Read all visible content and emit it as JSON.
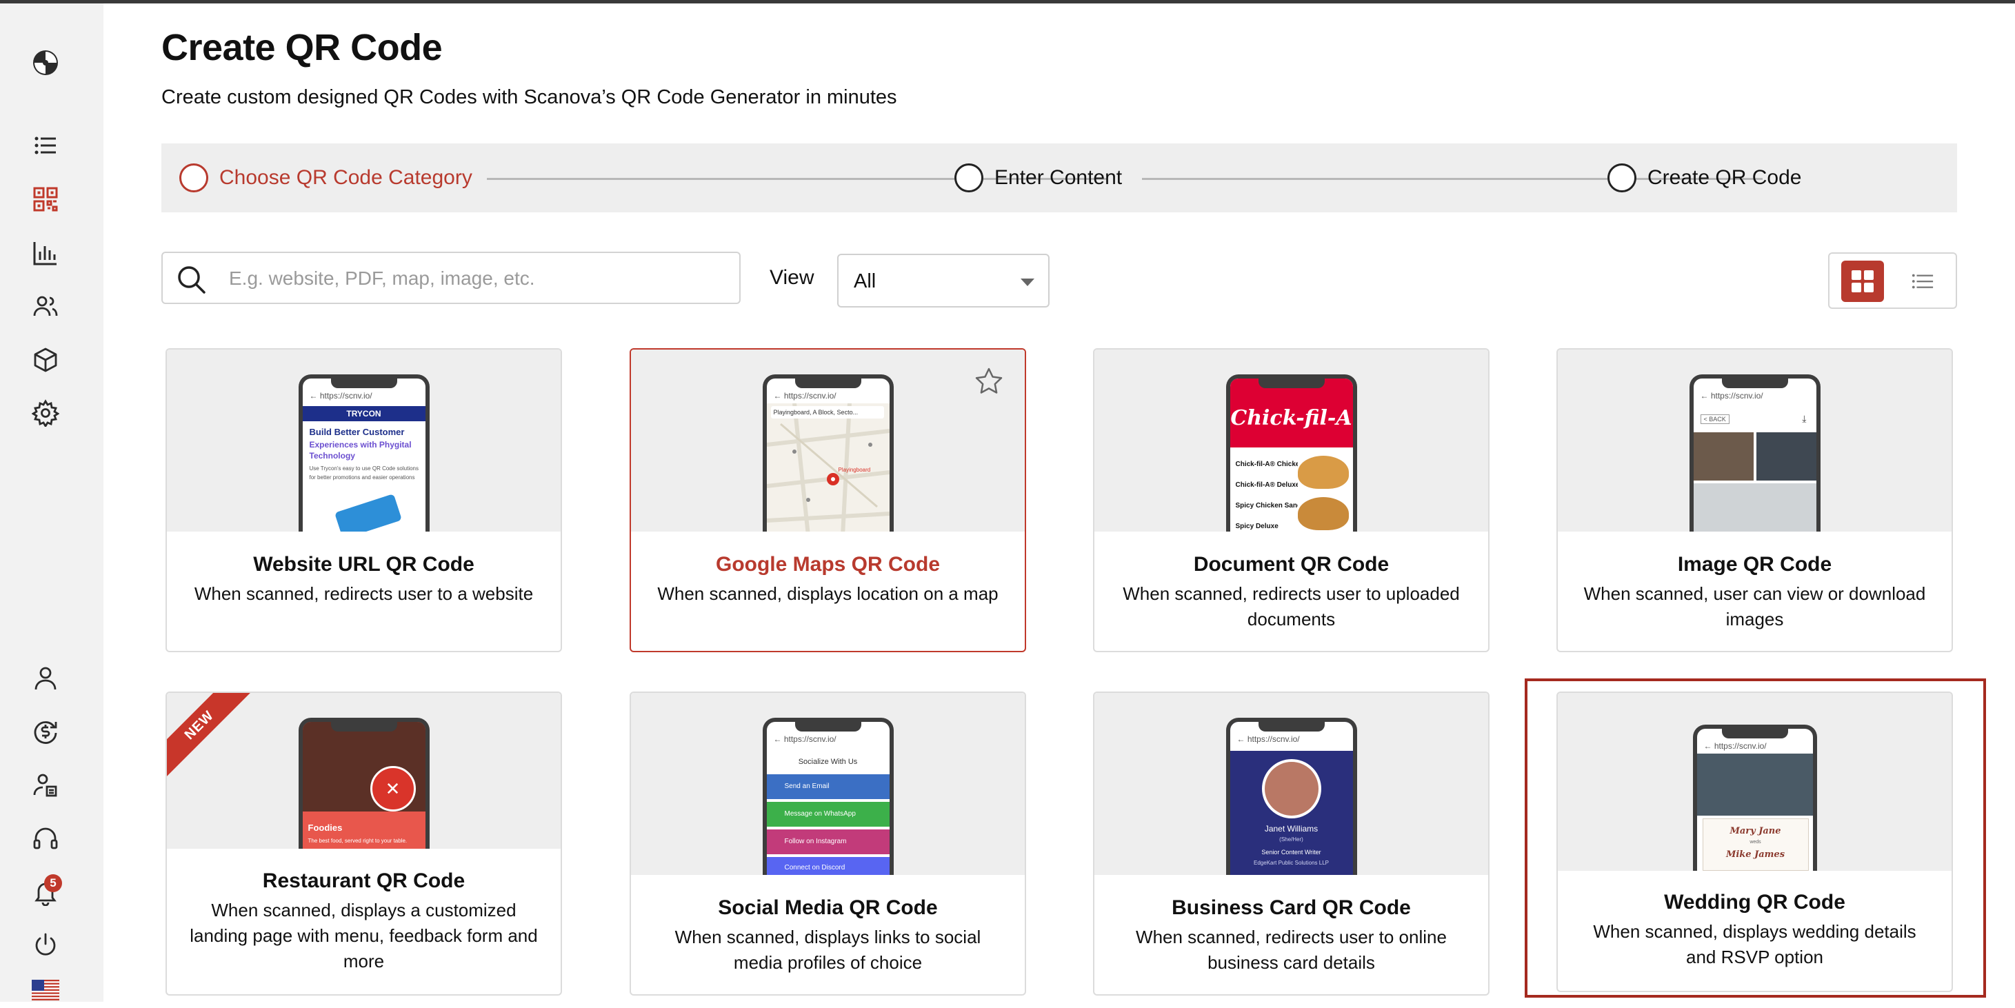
{
  "page": {
    "title": "Create QR Code",
    "subtitle": "Create custom designed QR Codes with Scanova’s QR Code Generator in minutes"
  },
  "sidebar": {
    "icons": [
      "logo-icon",
      "list-icon",
      "qr-icon",
      "chart-icon",
      "users-icon",
      "box-icon",
      "gear-icon",
      "user-icon",
      "billing-icon",
      "admin-user-icon",
      "headset-icon",
      "bell-icon",
      "power-icon",
      "us-flag-icon"
    ],
    "notification_count": "5",
    "accent": "#c0392b"
  },
  "stepper": {
    "steps": [
      {
        "label": "Choose QR Code Category",
        "active": true
      },
      {
        "label": "Enter Content",
        "active": false
      },
      {
        "label": "Create QR Code",
        "active": false
      }
    ]
  },
  "toolbar": {
    "search_placeholder": "E.g. website, PDF, map, image, etc.",
    "view_label": "View",
    "view_value": "All"
  },
  "cards": [
    {
      "title": "Website URL QR Code",
      "desc": "When scanned, redirects user to a website",
      "preview": {
        "url": "← https://scnv.io/",
        "brand": "TRYCON",
        "headline": "Build Better Customer",
        "subline": "Experiences with Phygital Technology",
        "body": "Use Trycon's easy to use QR Code solutions for better promotions and easier operations"
      }
    },
    {
      "title": "Google Maps QR Code",
      "desc": "When scanned, displays location on a map",
      "preview": {
        "url": "← https://scnv.io/",
        "search": "Playingboard, A Block, Secto...",
        "pin": "Playingboard"
      }
    },
    {
      "title": "Document QR Code",
      "desc": "When scanned, redirects user to uploaded documents",
      "preview": {
        "brand": "Chick-fil-A",
        "items": [
          "Chick-fil-A® Chicken",
          "Chick-fil-A® Deluxe",
          "Spicy Chicken Sandwich",
          "Spicy Deluxe"
        ]
      }
    },
    {
      "title": "Image QR Code",
      "desc": "When scanned, user can view or download images",
      "preview": {
        "url": "← https://scnv.io/",
        "back": "< BACK"
      }
    },
    {
      "title": "Restaurant QR Code",
      "desc": "When scanned, displays a customized landing page with menu, feedback form and more",
      "badge": "NEW",
      "preview": {
        "name": "Foodies",
        "tag": "The best food, served right to your table."
      }
    },
    {
      "title": "Social Media QR Code",
      "desc": "When scanned, displays links to social media profiles of choice",
      "preview": {
        "url": "← https://scnv.io/",
        "header": "Socialize With Us",
        "links": [
          {
            "label": "Send an Email",
            "color": "#3b6fc4"
          },
          {
            "label": "Message on WhatsApp",
            "color": "#3cb04a"
          },
          {
            "label": "Follow on Instagram",
            "color": "#c23b7a"
          },
          {
            "label": "Connect on Discord",
            "color": "#5865f2"
          }
        ]
      }
    },
    {
      "title": "Business Card QR Code",
      "desc": "When scanned, redirects user to online business card details",
      "preview": {
        "url": "← https://scnv.io/",
        "name": "Janet Williams",
        "pronoun": "(She/Her)",
        "role": "Senior Content Writer",
        "company": "EdgeKart Public Solutions LLP"
      }
    },
    {
      "title": "Wedding QR Code",
      "desc": "When scanned, displays wedding details and RSVP option",
      "preview": {
        "url": "← https://scnv.io/",
        "name1": "Mary Jane",
        "weds": "weds",
        "name2": "Mike James"
      }
    }
  ]
}
